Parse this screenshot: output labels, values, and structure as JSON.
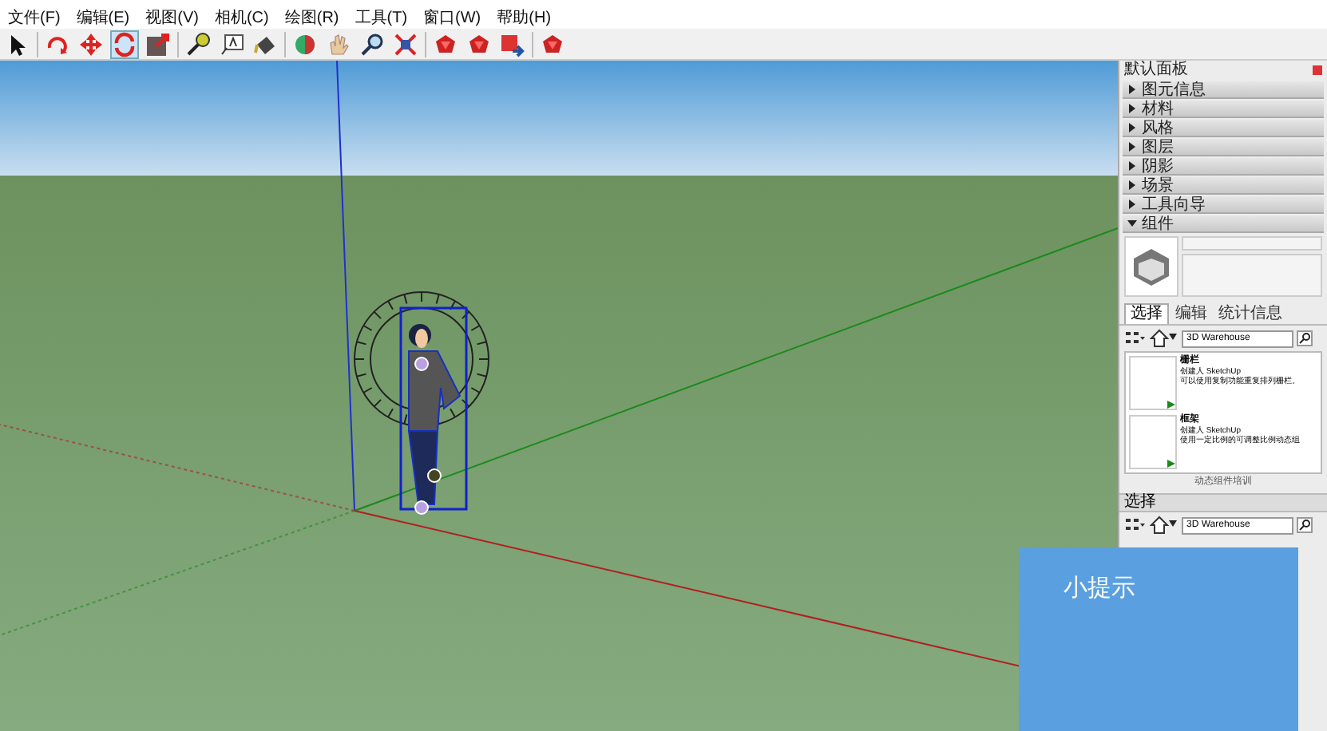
{
  "menu": [
    "文件(F)",
    "编辑(E)",
    "视图(V)",
    "相机(C)",
    "绘图(R)",
    "工具(T)",
    "窗口(W)",
    "帮助(H)"
  ],
  "toolbar": [
    {
      "kind": "select",
      "selected": false
    },
    {
      "kind": "sep"
    },
    {
      "kind": "rotate",
      "selected": false
    },
    {
      "kind": "move",
      "selected": false
    },
    {
      "kind": "orbit",
      "selected": true
    },
    {
      "kind": "scale",
      "selected": false
    },
    {
      "kind": "sep"
    },
    {
      "kind": "tape",
      "selected": false
    },
    {
      "kind": "text",
      "selected": false
    },
    {
      "kind": "paint",
      "selected": false
    },
    {
      "kind": "sep"
    },
    {
      "kind": "walk",
      "selected": false
    },
    {
      "kind": "hand",
      "selected": false
    },
    {
      "kind": "zoom",
      "selected": false
    },
    {
      "kind": "extents",
      "selected": false
    },
    {
      "kind": "sep"
    },
    {
      "kind": "gem",
      "selected": false
    },
    {
      "kind": "gem",
      "selected": false
    },
    {
      "kind": "share",
      "selected": false
    },
    {
      "kind": "sep"
    },
    {
      "kind": "gem",
      "selected": false
    }
  ],
  "tray": {
    "title": "默认面板",
    "sections": [
      {
        "label": "图元信息",
        "expanded": false
      },
      {
        "label": "材料",
        "expanded": false
      },
      {
        "label": "风格",
        "expanded": false
      },
      {
        "label": "图层",
        "expanded": false
      },
      {
        "label": "阴影",
        "expanded": false
      },
      {
        "label": "场景",
        "expanded": false
      },
      {
        "label": "工具向导",
        "expanded": false
      },
      {
        "label": "组件",
        "expanded": true
      }
    ],
    "tabs": [
      {
        "label": "选择",
        "selected": true
      },
      {
        "label": "编辑",
        "selected": false
      },
      {
        "label": "统计信息",
        "selected": false
      }
    ],
    "search": {
      "value": "3D Warehouse"
    },
    "components": [
      {
        "name": "栅栏",
        "author": "创建人 SketchUp",
        "description": "可以使用复制功能重复排列栅栏。"
      },
      {
        "name": "框架",
        "author": "创建人 SketchUp",
        "description": "使用一定比例的可调整比例动态组"
      }
    ],
    "footer": "动态组件培训",
    "second_header": "选择",
    "second_search": {
      "value": "3D Warehouse"
    }
  },
  "tip": {
    "title": "小提示"
  }
}
